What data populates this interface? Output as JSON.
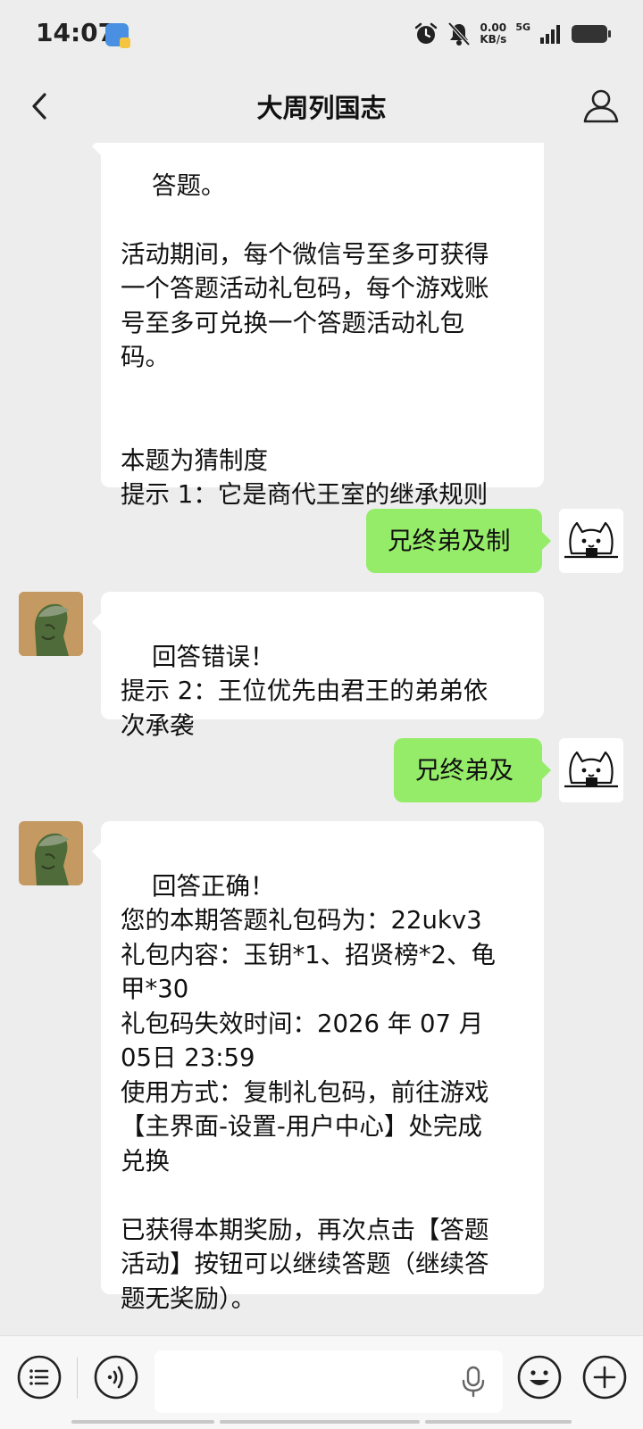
{
  "status_bar": {
    "time": "14:07",
    "net_speed_value": "0.00",
    "net_speed_unit": "KB/s",
    "network": "5G"
  },
  "header": {
    "title": "大周列国志"
  },
  "messages": [
    {
      "sender": "official",
      "text": "答题。\n\n活动期间，每个微信号至多可获得\n一个答题活动礼包码，每个游戏账\n号至多可兑换一个答题活动礼包\n码。\n\n\n本题为猜制度\n提示 1：它是商代王室的继承规则"
    },
    {
      "sender": "user",
      "text": "兄终弟及制"
    },
    {
      "sender": "official",
      "text": "回答错误！\n提示 2：王位优先由君王的弟弟依\n次承袭"
    },
    {
      "sender": "user",
      "text": "兄终弟及"
    },
    {
      "sender": "official",
      "text": "回答正确！\n您的本期答题礼包码为：22ukv3\n礼包内容：玉钥*1、招贤榜*2、龟\n甲*30\n礼包码失效时间：2026 年 07 月\n05日 23:59\n使用方式：复制礼包码，前往游戏\n【主界面-设置-用户中心】处完成\n兑换\n\n已获得本期奖励，再次点击【答题\n活动】按钮可以继续答题（继续答\n题无奖励）。"
    }
  ],
  "input_bar": {
    "icons": [
      "menu-list-icon",
      "voice-icon",
      "mic-icon",
      "emoji-icon",
      "plus-icon"
    ]
  },
  "colors": {
    "background": "#ededed",
    "outgoing_bubble": "#95ec69",
    "incoming_bubble": "#ffffff"
  }
}
